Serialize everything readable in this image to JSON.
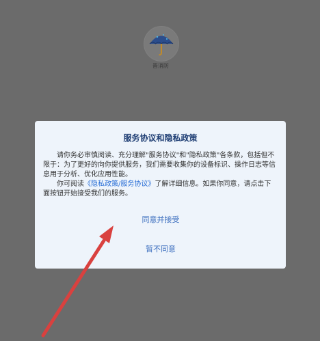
{
  "app": {
    "name": "晋消防",
    "logo_icon": "umbrella-icon"
  },
  "dialog": {
    "title": "服务协议和隐私政策",
    "paragraph1": "请你务必审慎阅读、充分理解\"服务协议\"和\"隐私政策\"各条款，包括但不限于：为了更好的向你提供服务，我们需要收集你的设备标识、操作日志等信息用于分析、优化应用性能。",
    "paragraph2_prefix": "你可阅读",
    "policy_link": "《隐私政策/服务协议》",
    "paragraph2_suffix": "了解详细信息。如果你同意，请点击下面按钮开始接受我们的服务。",
    "accept_label": "同意并接受",
    "decline_label": "暂不同意"
  },
  "colors": {
    "overlay": "#6b6b6b",
    "dialog_bg": "#eef4fb",
    "title": "#1f3e74",
    "link": "#2a6fd6",
    "button_text": "#3d6fbf",
    "annotation_arrow": "#d9413f"
  }
}
